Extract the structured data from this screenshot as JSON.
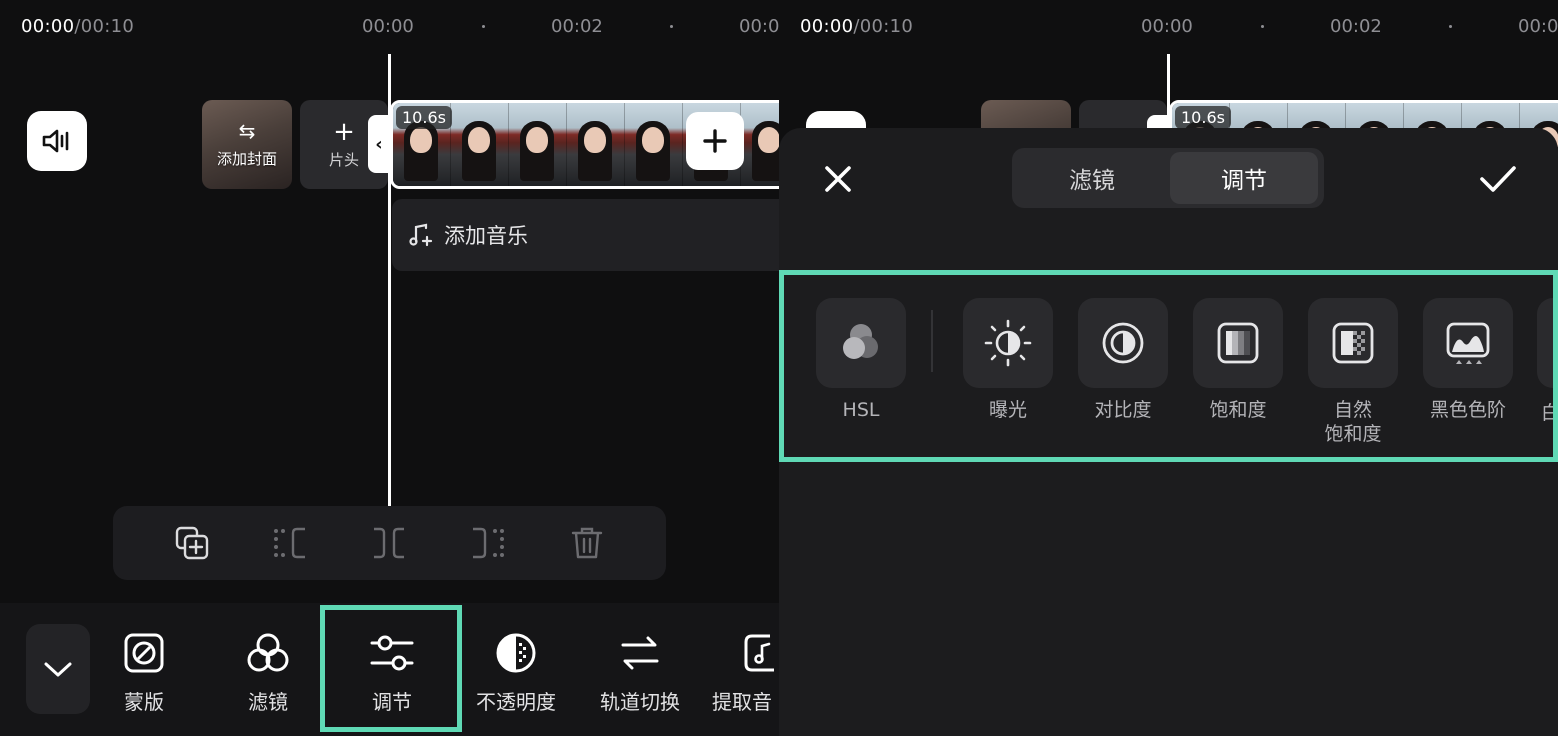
{
  "colors": {
    "accent_highlight": "#5fd9b5",
    "background": "#0f0f10",
    "sheet": "#1c1c1e"
  },
  "left": {
    "timecode": {
      "current": "00:00",
      "total": "/00:10"
    },
    "ruler": [
      "00:00",
      "00:02",
      "00:0"
    ],
    "cover_label": "添加封面",
    "intro_label": "片头",
    "clip_duration": "10.6s",
    "music_label": "添加音乐",
    "edit_tools": [
      "copy-icon",
      "split-left-icon",
      "split-icon",
      "split-right-icon",
      "trash-icon"
    ],
    "bottom_tools": [
      {
        "label": "蒙版",
        "icon": "mask-icon"
      },
      {
        "label": "滤镜",
        "icon": "filter-icon"
      },
      {
        "label": "调节",
        "icon": "adjust-icon",
        "selected": true
      },
      {
        "label": "不透明度",
        "icon": "opacity-icon"
      },
      {
        "label": "轨道切换",
        "icon": "track-switch-icon"
      },
      {
        "label": "提取音",
        "icon": "extract-audio-icon"
      }
    ]
  },
  "right": {
    "timecode": {
      "current": "00:00",
      "total": "/00:10"
    },
    "ruler": [
      "00:00",
      "00:02",
      "00:0"
    ],
    "clip_duration": "10.6s",
    "tabs": [
      {
        "label": "滤镜",
        "active": false
      },
      {
        "label": "调节",
        "active": true
      }
    ],
    "adjustments": [
      {
        "label": "HSL",
        "icon": "hsl-icon"
      },
      {
        "label": "曝光",
        "icon": "exposure-icon"
      },
      {
        "label": "对比度",
        "icon": "contrast-icon"
      },
      {
        "label": "饱和度",
        "icon": "saturation-icon"
      },
      {
        "label": "自然\n饱和度",
        "icon": "vibrance-icon"
      },
      {
        "label": "黑色色阶",
        "icon": "black-levels-icon"
      }
    ],
    "partial_label": "白"
  }
}
